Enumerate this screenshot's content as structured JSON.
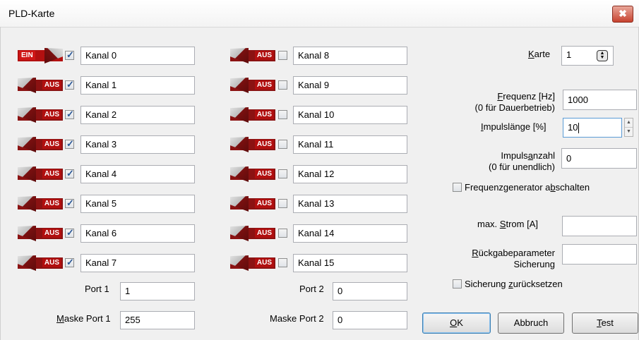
{
  "window": {
    "title": "PLD-Karte",
    "close_glyph": "✖"
  },
  "left_channels": [
    {
      "state": "EIN",
      "checked": true,
      "label": "Kanal 0"
    },
    {
      "state": "AUS",
      "checked": true,
      "label": "Kanal 1"
    },
    {
      "state": "AUS",
      "checked": true,
      "label": "Kanal 2"
    },
    {
      "state": "AUS",
      "checked": true,
      "label": "Kanal 3"
    },
    {
      "state": "AUS",
      "checked": true,
      "label": "Kanal 4"
    },
    {
      "state": "AUS",
      "checked": true,
      "label": "Kanal 5"
    },
    {
      "state": "AUS",
      "checked": true,
      "label": "Kanal 6"
    },
    {
      "state": "AUS",
      "checked": true,
      "label": "Kanal 7"
    }
  ],
  "right_channels": [
    {
      "state": "AUS",
      "checked": false,
      "label": "Kanal 8"
    },
    {
      "state": "AUS",
      "checked": false,
      "label": "Kanal 9"
    },
    {
      "state": "AUS",
      "checked": false,
      "label": "Kanal 10"
    },
    {
      "state": "AUS",
      "checked": false,
      "label": "Kanal 11"
    },
    {
      "state": "AUS",
      "checked": false,
      "label": "Kanal 12"
    },
    {
      "state": "AUS",
      "checked": false,
      "label": "Kanal 13"
    },
    {
      "state": "AUS",
      "checked": false,
      "label": "Kanal 14"
    },
    {
      "state": "AUS",
      "checked": false,
      "label": "Kanal 15"
    }
  ],
  "port1": {
    "label": "Port 1",
    "value": "1"
  },
  "maske1": {
    "label_pre": "",
    "label_ul": "M",
    "label_post": "aske Port 1",
    "value": "255"
  },
  "port2": {
    "label": "Port 2",
    "value": "0"
  },
  "maske2": {
    "label": "Maske Port 2",
    "value": "0"
  },
  "karte": {
    "label_ul": "K",
    "label_post": "arte",
    "value": "1"
  },
  "frequenz": {
    "label_ul": "F",
    "label_post": "requenz [Hz]",
    "label_line2": "(0 für Dauerbetrieb)",
    "value": "1000"
  },
  "impulslaenge": {
    "label_ul": "I",
    "label_post": "mpulslänge [%]",
    "value": "10"
  },
  "impulsanzahl": {
    "label_pre": "Impuls",
    "label_ul": "a",
    "label_post": "nzahl",
    "label_line2": "(0 für unendlich)",
    "value": "0"
  },
  "freqgen": {
    "label_pre": "Frequenzgenerator a",
    "label_ul": "b",
    "label_post": "schalten",
    "checked": false
  },
  "strom": {
    "label_pre": "max. ",
    "label_ul": "S",
    "label_post": "trom [A]",
    "value": ""
  },
  "rueckgabe": {
    "label_ul": "R",
    "label_post": "ückgabeparameter",
    "label_line2": "Sicherung",
    "value": ""
  },
  "sicherung": {
    "label_pre": "Sicherung ",
    "label_ul": "z",
    "label_post": "urücksetzen",
    "checked": false
  },
  "buttons": {
    "ok_ul": "O",
    "ok_post": "K",
    "cancel": "Abbruch",
    "test_ul": "T",
    "test_post": "est"
  },
  "icons": {
    "spin_up": "▲",
    "spin_down": "▼",
    "check": "✓"
  }
}
